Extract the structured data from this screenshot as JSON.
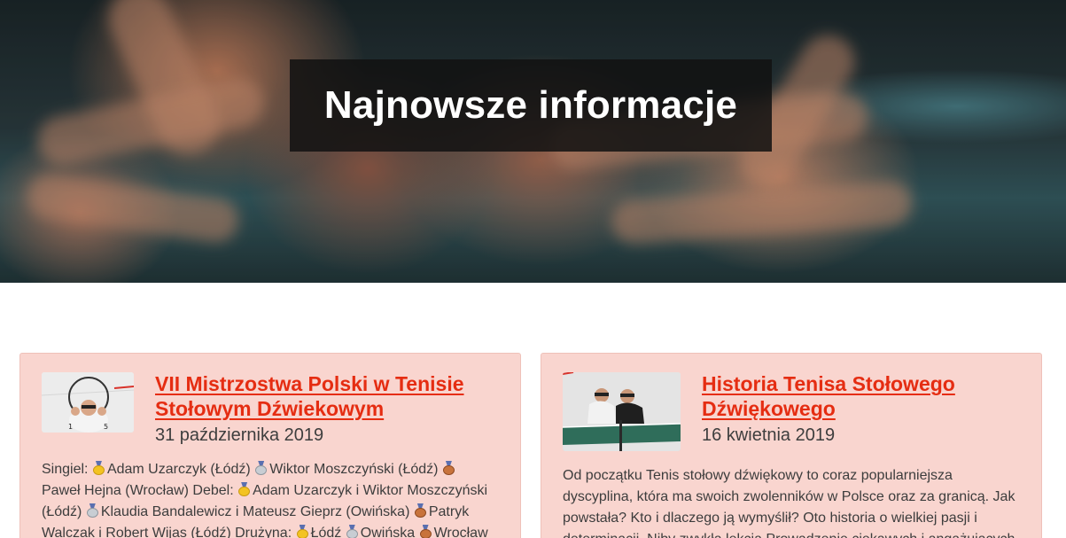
{
  "hero": {
    "title": "Najnowsze informacje"
  },
  "posts": [
    {
      "title_line1": "VII Mistrzostwa Polski w Tenisie",
      "title_line2": "Stołowym Dźwiekowym",
      "date": "31 października 2019",
      "excerpt": {
        "s1": "Singiel:",
        "s2": "Adam Uzarczyk (Łódź)",
        "s3": "Wiktor Moszczyński (Łódź)",
        "s4": "Paweł Hejna (Wrocław) Debel:",
        "s5": "Adam Uzarczyk i Wiktor Moszczyński (Łódź)",
        "s6": "Klaudia Bandalewicz i Mateusz Gieprz (Owińska)",
        "s7": "Patryk Walczak i Robert Wijas (Łódź) Drużyna:",
        "s8": "Łódź",
        "s9": "Owińska",
        "s10": "Wrocław"
      },
      "medal_icons": [
        "gold-medal",
        "silver-medal",
        "bronze-medal"
      ]
    },
    {
      "title_line1": "Historia Tenisa Stołowego",
      "title_line2": "Dźwiękowego",
      "date": "16 kwietnia 2019",
      "excerpt_text": "Od początku Tenis stołowy dźwiękowy to coraz popularniejsza dyscyplina, która ma swoich zwolenników w Polsce oraz za granicą. Jak powstała? Kto i dlaczego ją wymyślił? Oto historia o wielkiej pasji i determinacji. Niby zwykła lekcja Prowadzenie ciekawych i angażujących"
    }
  ],
  "colors": {
    "accent": "#e52d12",
    "card_bg": "#f9d5cf",
    "title_box": "#121212"
  }
}
